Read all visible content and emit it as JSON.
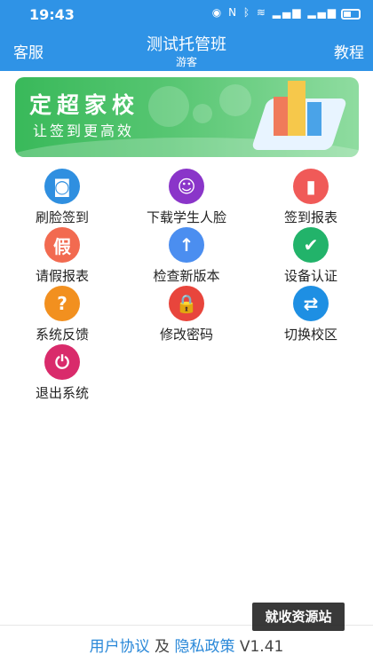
{
  "status_bar": {
    "time": "19:43",
    "icons": [
      "eye-icon",
      "nfc-icon",
      "bluetooth-icon",
      "wifi-icon",
      "signal-4g-icon",
      "signal-4g-icon",
      "battery-icon"
    ]
  },
  "header": {
    "left": "客服",
    "title": "测试托管班",
    "subtitle": "游客",
    "right": "教程",
    "color": "#2f93e6"
  },
  "banner": {
    "title": "定超家校",
    "subtitle": "让签到更高效"
  },
  "menu": [
    {
      "label": "刷脸签到",
      "icon": "face-scan-icon",
      "color": "#2f8fe0",
      "glyph": "◙"
    },
    {
      "label": "下载学生人脸",
      "icon": "user-download-icon",
      "color": "#8a35c9",
      "glyph": "☺"
    },
    {
      "label": "签到报表",
      "icon": "report-chart-icon",
      "color": "#f05a58",
      "glyph": "▮"
    },
    {
      "label": "请假报表",
      "icon": "leave-icon",
      "color": "#f26a50",
      "glyph": "假"
    },
    {
      "label": "检查新版本",
      "icon": "upgrade-arrow-icon",
      "color": "#4b8ef0",
      "glyph": "↑"
    },
    {
      "label": "设备认证",
      "icon": "device-verify-icon",
      "color": "#22b36a",
      "glyph": "✔"
    },
    {
      "label": "系统反馈",
      "icon": "feedback-question-icon",
      "color": "#f2901f",
      "glyph": "?"
    },
    {
      "label": "修改密码",
      "icon": "lock-icon",
      "color": "#e8453c",
      "glyph": "🔒"
    },
    {
      "label": "切换校区",
      "icon": "switch-icon",
      "color": "#1e8fe3",
      "glyph": "⇄"
    },
    {
      "label": "退出系统",
      "icon": "power-icon",
      "color": "#d92b6b",
      "glyph": "⏻"
    }
  ],
  "footer": {
    "user_agreement": "用户协议",
    "and": "及",
    "privacy_policy": "隐私政策",
    "version": "V1.41"
  },
  "watermark": "就收资源站"
}
